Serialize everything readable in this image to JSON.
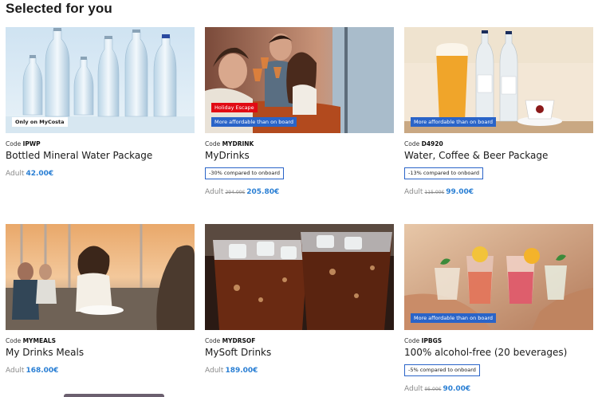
{
  "section": {
    "title": "Selected for you"
  },
  "cards": [
    {
      "code_prefix": "Code",
      "code": "IPWP",
      "name": "Bottled Mineral Water Package",
      "adult_label": "Adult",
      "old_price": "",
      "price": "42.00€",
      "discount": "",
      "badges": [
        "Only on MyCosta"
      ]
    },
    {
      "code_prefix": "Code",
      "code": "MYDRINK",
      "name": "MyDrinks",
      "adult_label": "Adult",
      "old_price": "294.00€",
      "price": "205.80€",
      "discount": "-30% compared to onboard",
      "badges": [
        "Holiday Escape",
        "More affordable than on board"
      ]
    },
    {
      "code_prefix": "Code",
      "code": "D4920",
      "name": "Water, Coffee & Beer Package",
      "adult_label": "Adult",
      "old_price": "115.00€",
      "price": "99.00€",
      "discount": "-13% compared to onboard",
      "badges": [
        "More affordable than on board"
      ]
    },
    {
      "code_prefix": "Code",
      "code": "MYMEALS",
      "name": "My Drinks Meals",
      "adult_label": "Adult",
      "old_price": "",
      "price": "168.00€",
      "discount": "",
      "badges": []
    },
    {
      "code_prefix": "Code",
      "code": "MYDRSOF",
      "name": "MySoft Drinks",
      "adult_label": "Adult",
      "old_price": "",
      "price": "189.00€",
      "discount": "",
      "badges": []
    },
    {
      "code_prefix": "Code",
      "code": "IPBGS",
      "name": "100% alcohol-free (20 beverages)",
      "adult_label": "Adult",
      "old_price": "95.00€",
      "price": "90.00€",
      "discount": "-5% compared to onboard",
      "badges": [
        "More affordable than on board"
      ]
    }
  ],
  "colors": {
    "accent_blue": "#2a64c8",
    "price_blue": "#2a7fd4",
    "promo_red": "#e10a14"
  }
}
